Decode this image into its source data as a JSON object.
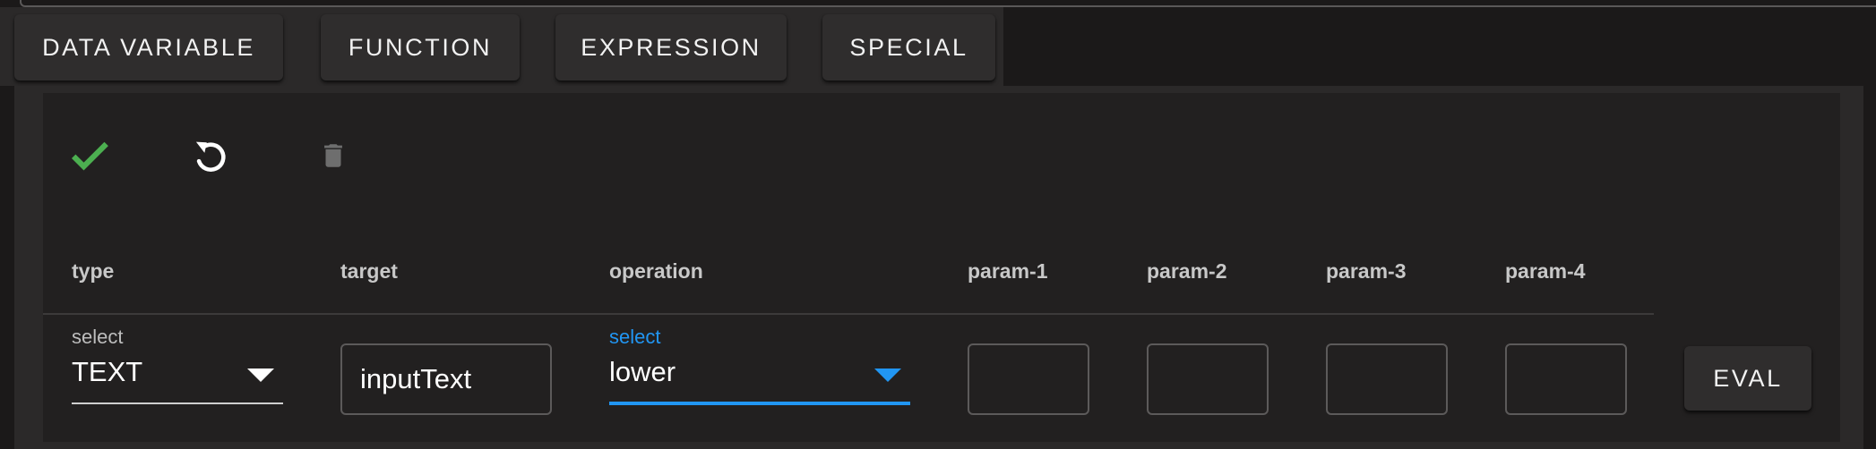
{
  "tabs": {
    "data_variable": "DATA VARIABLE",
    "function": "FUNCTION",
    "expression": "EXPRESSION",
    "special": "SPECIAL"
  },
  "toolbar": {
    "confirm_icon": "check-icon",
    "reset_icon": "undo-icon",
    "delete_icon": "trash-icon",
    "confirm_color": "#4caf50",
    "delete_color": "#6e6e6e"
  },
  "columns": {
    "type": "type",
    "target": "target",
    "operation": "operation",
    "param1": "param-1",
    "param2": "param-2",
    "param3": "param-3",
    "param4": "param-4"
  },
  "row": {
    "type_select": {
      "label": "select",
      "value": "TEXT"
    },
    "target_value": "inputText",
    "operation_select": {
      "label": "select",
      "value": "lower",
      "accent_color": "#2196f3"
    },
    "param1": "",
    "param2": "",
    "param3": "",
    "param4": ""
  },
  "eval_button": "EVAL"
}
